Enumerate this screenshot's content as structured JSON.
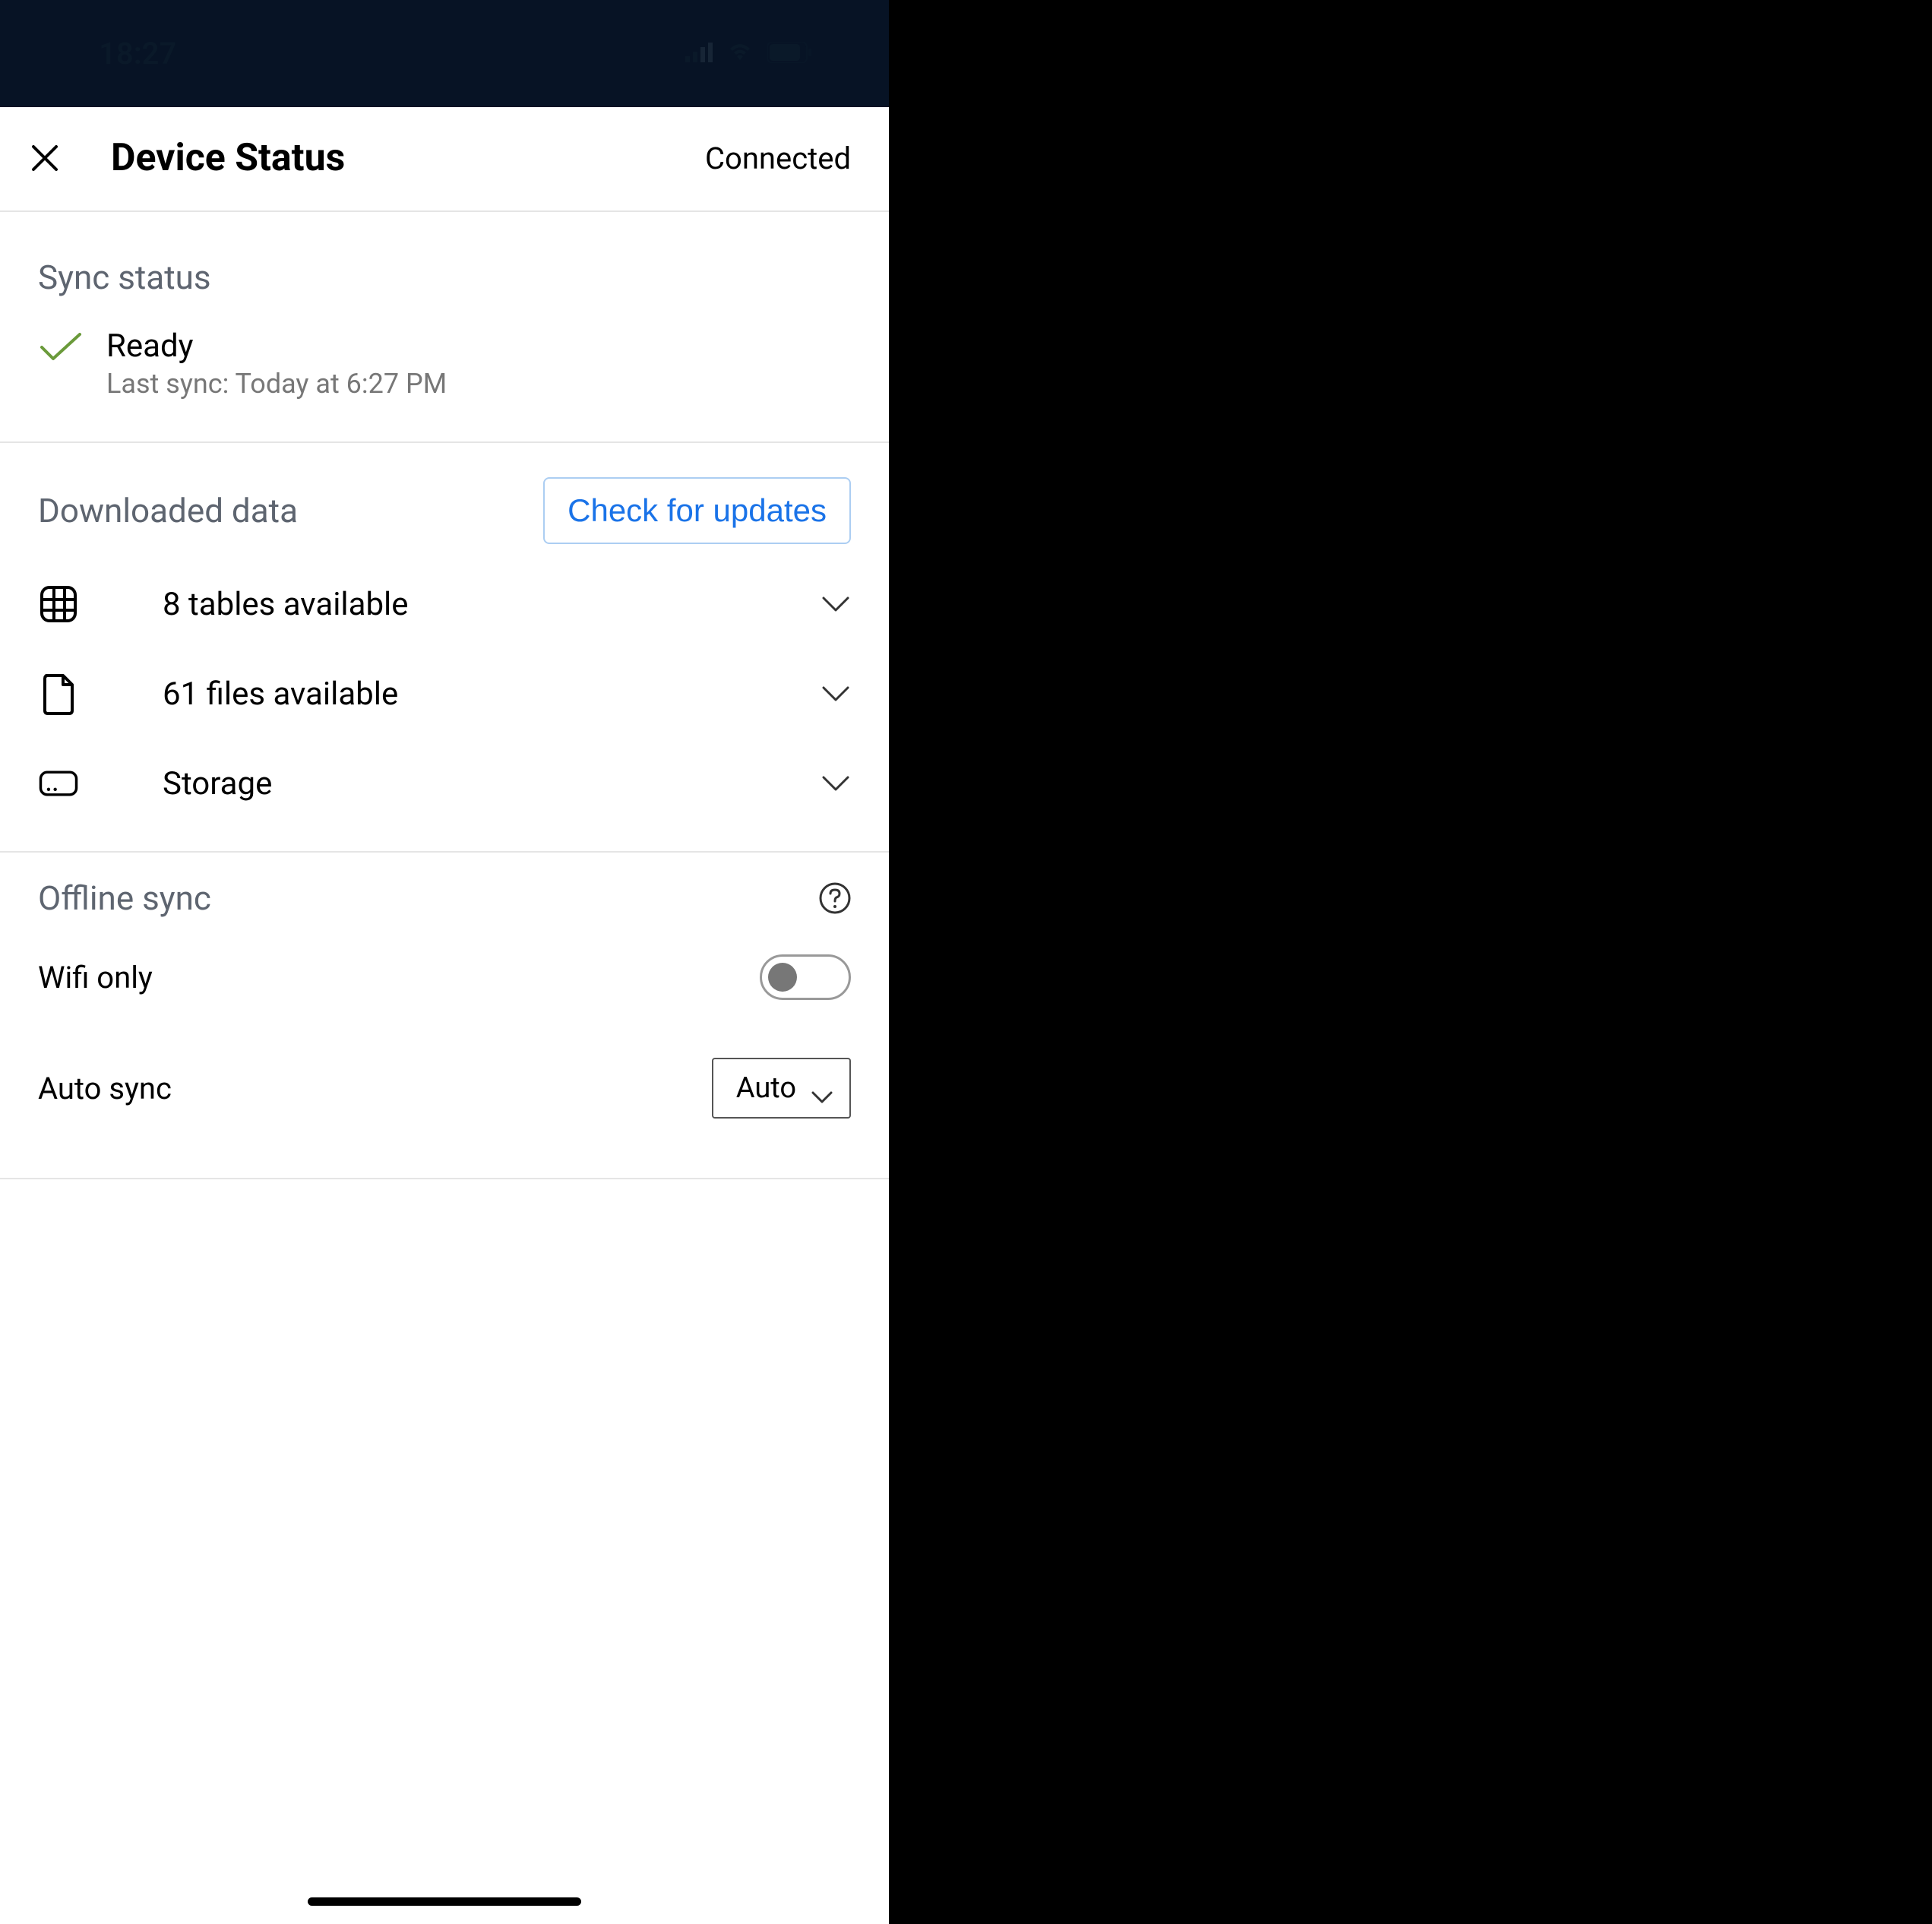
{
  "status_bar": {
    "time": "18:27"
  },
  "header": {
    "title": "Device Status",
    "connection": "Connected"
  },
  "sync_status": {
    "section_label": "Sync status",
    "title": "Ready",
    "subtitle": "Last sync: Today at 6:27 PM"
  },
  "downloaded": {
    "section_label": "Downloaded data",
    "button_label": "Check for updates",
    "rows": {
      "tables": "8 tables available",
      "files": "61 files available",
      "storage": "Storage"
    }
  },
  "offline": {
    "section_label": "Offline sync",
    "wifi_only_label": "Wifi only",
    "auto_sync_label": "Auto sync",
    "auto_sync_value": "Auto"
  }
}
